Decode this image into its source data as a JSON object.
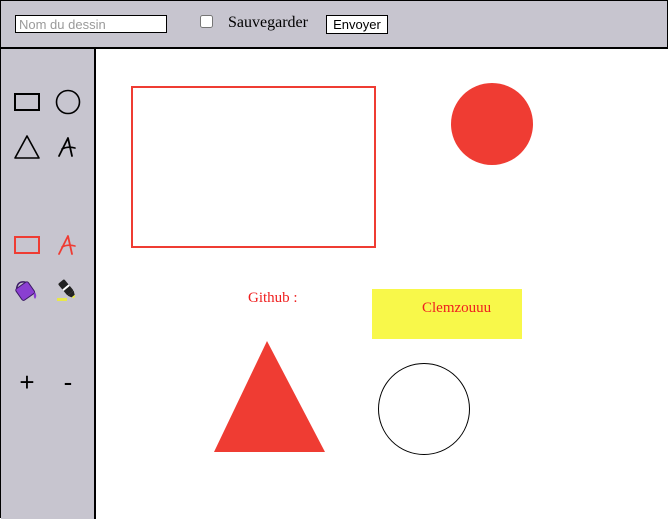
{
  "topbar": {
    "name_placeholder": "Nom du dessin",
    "name_value": "",
    "save_label": "Sauvegarder",
    "save_checked": false,
    "send_label": "Envoyer"
  },
  "sidebar": {
    "tools": [
      {
        "id": "rectangle",
        "icon": "rectangle-icon"
      },
      {
        "id": "circle",
        "icon": "circle-icon"
      },
      {
        "id": "triangle",
        "icon": "triangle-icon"
      },
      {
        "id": "text",
        "icon": "text-a-icon"
      },
      {
        "id": "stroke-color",
        "icon": "rectangle-outline-red-icon"
      },
      {
        "id": "text-color",
        "icon": "text-a-red-icon"
      },
      {
        "id": "fill",
        "icon": "paint-bucket-icon"
      },
      {
        "id": "highlighter",
        "icon": "highlighter-icon"
      }
    ],
    "zoom_in_label": "+",
    "zoom_out_label": "-"
  },
  "canvas": {
    "github_label": "Github :",
    "github_username": "Clemzouuu"
  },
  "colors": {
    "panel": "#c7c5cf",
    "accent_red": "#ef3c33",
    "text_red": "#ef1f1f",
    "yellow": "#f8f84a",
    "bucket_purple": "#8a3fd1"
  }
}
